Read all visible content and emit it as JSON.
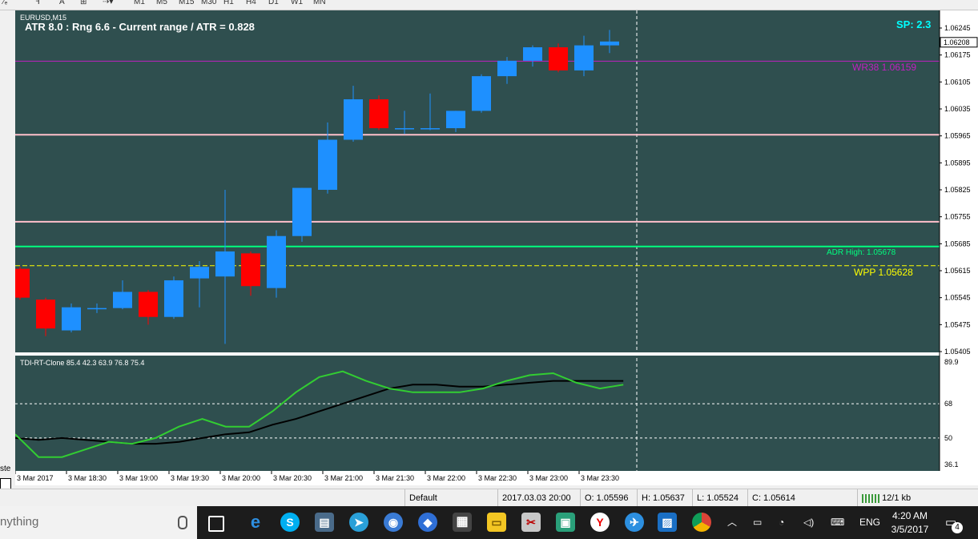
{
  "toolbar": {
    "timeframes": [
      "M1",
      "M5",
      "M15",
      "M30",
      "H1",
      "H4",
      "D1",
      "W1",
      "MN"
    ]
  },
  "chart": {
    "symbol_title": "EURUSD,M15",
    "atr_text": "ATR 8.0 : Rng 6.6 - Current range / ATR = 0.828",
    "spread_text": "SP: 2.3",
    "price_labels": [
      "1.06245",
      "1.06175",
      "1.06105",
      "1.06035",
      "1.05965",
      "1.05895",
      "1.05825",
      "1.05755",
      "1.05685",
      "1.05615",
      "1.05545",
      "1.05475",
      "1.05405"
    ],
    "current_price": "1.06208",
    "wr38_label": "WR38  1.06159",
    "adr_high_label": "ADR High: 1.05678",
    "wpp_label": "WPP  1.05628",
    "levels": {
      "wr38": 1.06159,
      "pink_upper": 1.05968,
      "pink_lower": 1.05742,
      "adr_high": 1.05678,
      "wpp": 1.05628
    },
    "colors": {
      "bg": "#2f4f4f",
      "bull": "#1e90ff",
      "bear": "#ff0000",
      "wr38": "#c020c0",
      "pink": "#ffc0cb",
      "adr": "#00ff7f",
      "wpp": "#ffff00",
      "spread": "#00ffff"
    },
    "candles": [
      {
        "o": 1.0562,
        "h": 1.05625,
        "l": 1.0554,
        "c": 1.05545
      },
      {
        "o": 1.0554,
        "h": 1.05545,
        "l": 1.05445,
        "c": 1.05465
      },
      {
        "o": 1.0546,
        "h": 1.0553,
        "l": 1.05455,
        "c": 1.0552
      },
      {
        "o": 1.05518,
        "h": 1.0553,
        "l": 1.05505,
        "c": 1.05518
      },
      {
        "o": 1.05518,
        "h": 1.0559,
        "l": 1.05515,
        "c": 1.0556
      },
      {
        "o": 1.0556,
        "h": 1.05565,
        "l": 1.05475,
        "c": 1.05495
      },
      {
        "o": 1.05495,
        "h": 1.056,
        "l": 1.0549,
        "c": 1.0559
      },
      {
        "o": 1.05595,
        "h": 1.0564,
        "l": 1.0552,
        "c": 1.05625
      },
      {
        "o": 1.056,
        "h": 1.05825,
        "l": 1.05425,
        "c": 1.05665
      },
      {
        "o": 1.0566,
        "h": 1.05665,
        "l": 1.0555,
        "c": 1.05575
      },
      {
        "o": 1.0557,
        "h": 1.0572,
        "l": 1.05545,
        "c": 1.05705
      },
      {
        "o": 1.05705,
        "h": 1.0583,
        "l": 1.0569,
        "c": 1.0583
      },
      {
        "o": 1.05825,
        "h": 1.06,
        "l": 1.05815,
        "c": 1.05955
      },
      {
        "o": 1.05955,
        "h": 1.06095,
        "l": 1.0595,
        "c": 1.0606
      },
      {
        "o": 1.0606,
        "h": 1.0607,
        "l": 1.0598,
        "c": 1.05985
      },
      {
        "o": 1.05985,
        "h": 1.0603,
        "l": 1.0597,
        "c": 1.05985
      },
      {
        "o": 1.05985,
        "h": 1.06075,
        "l": 1.0598,
        "c": 1.05985
      },
      {
        "o": 1.05985,
        "h": 1.0603,
        "l": 1.05975,
        "c": 1.0603
      },
      {
        "o": 1.0603,
        "h": 1.06125,
        "l": 1.06025,
        "c": 1.0612
      },
      {
        "o": 1.0612,
        "h": 1.0617,
        "l": 1.061,
        "c": 1.0616
      },
      {
        "o": 1.0616,
        "h": 1.062,
        "l": 1.06145,
        "c": 1.06195
      },
      {
        "o": 1.06195,
        "h": 1.06205,
        "l": 1.0613,
        "c": 1.06135
      },
      {
        "o": 1.06135,
        "h": 1.06225,
        "l": 1.0612,
        "c": 1.062
      },
      {
        "o": 1.062,
        "h": 1.0624,
        "l": 1.0618,
        "c": 1.0621
      }
    ],
    "time_labels": [
      "3 Mar 2017",
      "3 Mar 18:30",
      "3 Mar 19:00",
      "3 Mar 19:30",
      "3 Mar 20:00",
      "3 Mar 20:30",
      "3 Mar 21:00",
      "3 Mar 21:30",
      "3 Mar 22:00",
      "3 Mar 22:30",
      "3 Mar 23:00",
      "3 Mar 23:30"
    ]
  },
  "indicator": {
    "title": "TDI-RT-Clone 85.4 42.3 63.9 76.8 75.4",
    "level_labels": [
      "89.9",
      "68",
      "50",
      "36.1"
    ],
    "levels": [
      89.9,
      68,
      50,
      36.1
    ],
    "green_line": [
      52,
      40,
      40,
      44,
      48,
      47,
      50,
      56,
      60,
      56,
      56,
      64,
      74,
      82,
      85,
      80,
      76,
      74,
      74,
      74,
      76,
      80,
      83,
      84,
      79,
      76,
      78
    ],
    "black_line": [
      50,
      49,
      50,
      49,
      48,
      47,
      47,
      48,
      50,
      52,
      53,
      57,
      60,
      64,
      68,
      72,
      76,
      78,
      78,
      77,
      77,
      78,
      79,
      80,
      80,
      80,
      80
    ]
  },
  "status": {
    "profile": "Default",
    "datetime": "2017.03.03 20:00",
    "open": "O: 1.05596",
    "high": "H: 1.05637",
    "low": "L: 1.05524",
    "close": "C: 1.05614",
    "traffic": "12/1 kb"
  },
  "taskbar": {
    "search_text": "nything",
    "language": "ENG",
    "time": "4:20 AM",
    "date": "3/5/2017",
    "notifications": "4"
  }
}
